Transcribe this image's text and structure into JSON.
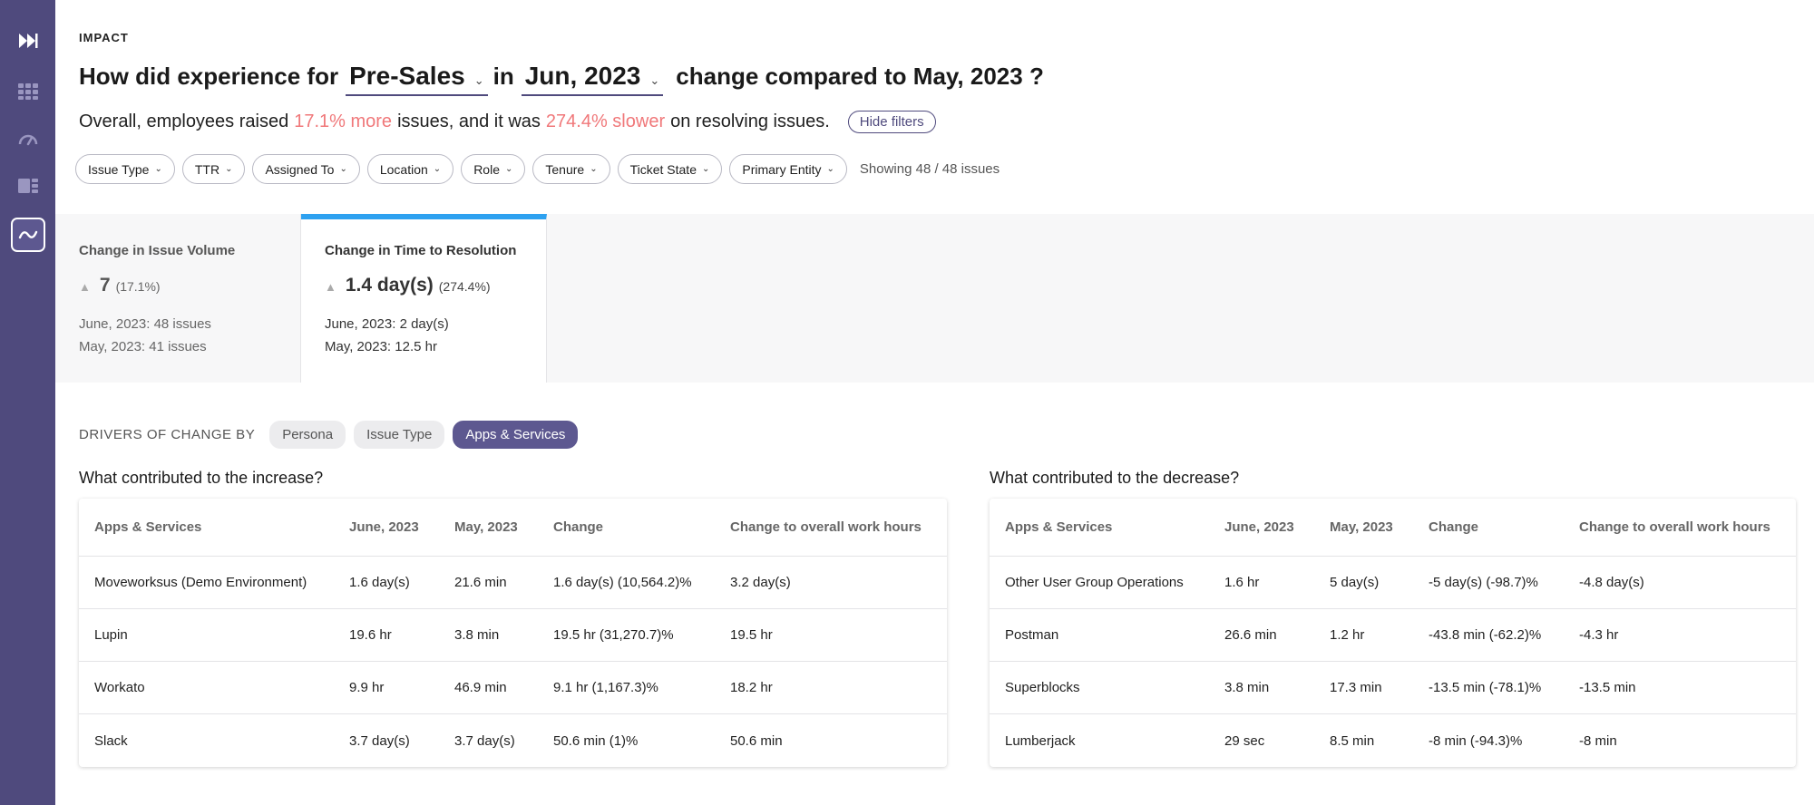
{
  "sidebar": {
    "items": [
      {
        "icon": "fast-forward-icon",
        "active": false
      },
      {
        "icon": "grid-icon",
        "active": false
      },
      {
        "icon": "gauge-icon",
        "active": false
      },
      {
        "icon": "dashboard-icon",
        "active": false
      },
      {
        "icon": "trend-icon",
        "active": true
      }
    ]
  },
  "header": {
    "eyebrow": "IMPACT",
    "q_prefix": "How did experience for",
    "persona_value": "Pre-Sales",
    "q_in": "in",
    "month_value": "Jun, 2023",
    "q_suffix": "change compared to May, 2023 ?"
  },
  "summary": {
    "part1": "Overall, employees raised",
    "volume_change": "17.1% more",
    "part2": "issues, and it was",
    "time_change": "274.4% slower",
    "part3": "on resolving issues.",
    "hide_filters": "Hide filters",
    "highlight_color": "#f0787a"
  },
  "filters": {
    "chips": [
      "Issue Type",
      "TTR",
      "Assigned To",
      "Location",
      "Role",
      "Tenure",
      "Ticket State",
      "Primary Entity"
    ],
    "showing": "Showing 48 / 48 issues"
  },
  "kpis": [
    {
      "title": "Change in Issue Volume",
      "value": "7",
      "pct": "(17.1%)",
      "current": "June, 2023: 48 issues",
      "previous": "May, 2023: 41 issues",
      "selected": false
    },
    {
      "title": "Change in Time to Resolution",
      "value": "1.4 day(s)",
      "pct": "(274.4%)",
      "current": "June, 2023: 2 day(s)",
      "previous": "May, 2023: 12.5 hr",
      "selected": true
    }
  ],
  "drivers": {
    "label": "DRIVERS OF CHANGE BY",
    "options": [
      "Persona",
      "Issue Type",
      "Apps & Services"
    ],
    "active": "Apps & Services",
    "accent": "#5d5890"
  },
  "increase": {
    "title": "What contributed to the increase?",
    "headers": [
      "Apps & Services",
      "June, 2023",
      "May, 2023",
      "Change",
      "Change to overall work hours"
    ],
    "rows": [
      [
        "Moveworksus (Demo Environment)",
        "1.6 day(s)",
        "21.6 min",
        "1.6 day(s) (10,564.2)%",
        "3.2 day(s)"
      ],
      [
        "Lupin",
        "19.6 hr",
        "3.8 min",
        "19.5 hr (31,270.7)%",
        "19.5 hr"
      ],
      [
        "Workato",
        "9.9 hr",
        "46.9 min",
        "9.1 hr (1,167.3)%",
        "18.2 hr"
      ],
      [
        "Slack",
        "3.7 day(s)",
        "3.7 day(s)",
        "50.6 min (1)%",
        "50.6 min"
      ]
    ]
  },
  "decrease": {
    "title": "What contributed to the decrease?",
    "headers": [
      "Apps & Services",
      "June, 2023",
      "May, 2023",
      "Change",
      "Change to overall work hours"
    ],
    "rows": [
      [
        "Other User Group Operations",
        "1.6 hr",
        "5 day(s)",
        "-5 day(s) (-98.7)%",
        "-4.8 day(s)"
      ],
      [
        "Postman",
        "26.6 min",
        "1.2 hr",
        "-43.8 min (-62.2)%",
        "-4.3 hr"
      ],
      [
        "Superblocks",
        "3.8 min",
        "17.3 min",
        "-13.5 min (-78.1)%",
        "-13.5 min"
      ],
      [
        "Lumberjack",
        "29 sec",
        "8.5 min",
        "-8 min (-94.3)%",
        "-8 min"
      ]
    ]
  }
}
